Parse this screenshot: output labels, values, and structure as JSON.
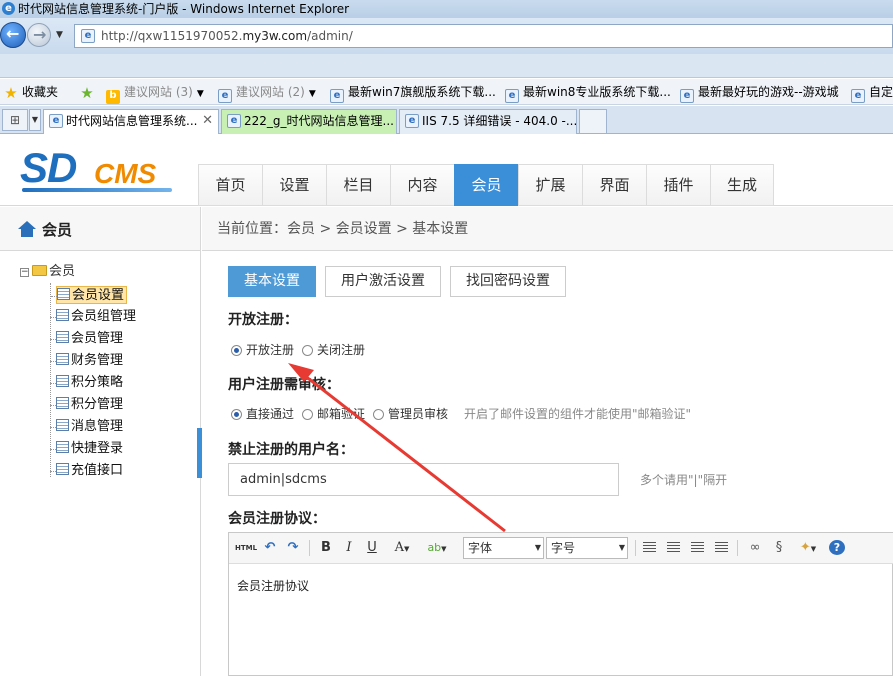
{
  "window": {
    "title": "时代网站信息管理系统-门户版 - Windows Internet Explorer"
  },
  "address": {
    "url_prefix": "http://qxw1151970052.",
    "url_domain": "my3w.com",
    "url_suffix": "/admin/"
  },
  "favorites": {
    "label": "收藏夹",
    "items": [
      {
        "label": "建议网站 (3)"
      },
      {
        "label": "建议网站 (2)"
      },
      {
        "label": "最新win7旗舰版系统下载..."
      },
      {
        "label": "最新win8专业版系统下载..."
      },
      {
        "label": "最新最好玩的游戏--游戏城"
      },
      {
        "label": "自定"
      }
    ]
  },
  "tabs": [
    {
      "label": "时代网站信息管理系统..."
    },
    {
      "label": "222_g_时代网站信息管理..."
    },
    {
      "label": "IIS 7.5 详细错误 - 404.0 -..."
    }
  ],
  "logo": {
    "sd": "SD",
    "cms": "CMS"
  },
  "mainnav": [
    "首页",
    "设置",
    "栏目",
    "内容",
    "会员",
    "扩展",
    "界面",
    "插件",
    "生成"
  ],
  "sidebar": {
    "title": "会员",
    "root": "会员",
    "items": [
      "会员设置",
      "会员组管理",
      "会员管理",
      "财务管理",
      "积分策略",
      "积分管理",
      "消息管理",
      "快捷登录",
      "充值接口"
    ]
  },
  "content": {
    "breadcrumb": "当前位置：会员 > 会员设置 > 基本设置",
    "subtabs": [
      "基本设置",
      "用户激活设置",
      "找回密码设置"
    ],
    "open_reg": {
      "label": "开放注册：",
      "options": [
        "开放注册",
        "关闭注册"
      ]
    },
    "reg_review": {
      "label": "用户注册需审核：",
      "options": [
        "直接通过",
        "邮箱验证",
        "管理员审核"
      ],
      "hint": "开启了邮件设置的组件才能使用\"邮箱验证\""
    },
    "banned": {
      "label": "禁止注册的用户名：",
      "value": "admin|sdcms",
      "hint": "多个请用\"|\"隔开"
    },
    "agreement": {
      "label": "会员注册协议：",
      "body": "会员注册协议"
    },
    "editor": {
      "font_select": "字体",
      "size_select": "字号",
      "html_btn": "HTML"
    }
  },
  "colors": {
    "accent": "#3b8fd8",
    "arrow": "#e63a32"
  }
}
